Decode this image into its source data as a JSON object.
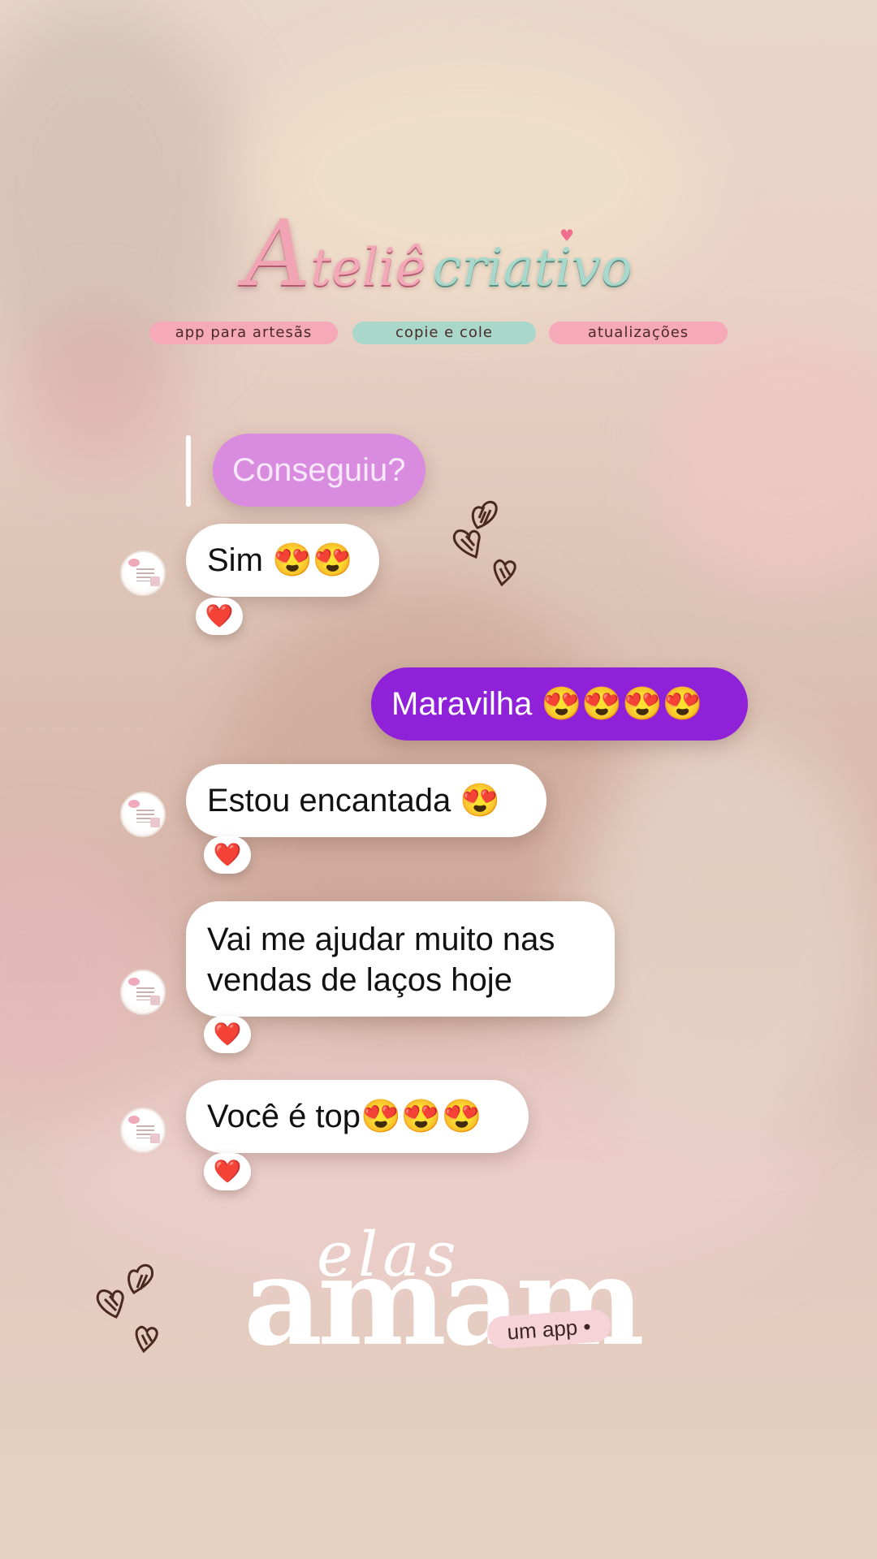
{
  "brand": {
    "logo_a": "A",
    "logo_telie": "teliê",
    "logo_criativo": "criativo",
    "tags": [
      "app para artesãs",
      "copie e cole",
      "atualizações"
    ],
    "accent_pink": "#f6a9b9",
    "accent_mint": "#a9d8cb"
  },
  "chat": {
    "reply_quote": "Conseguiu?",
    "messages": [
      {
        "text": "Sim ",
        "emoji": "😍😍",
        "reaction": "❤️"
      },
      {
        "text": "Maravilha ",
        "emoji": "😍😍😍😍",
        "outgoing": true
      },
      {
        "text": "Estou encantada ",
        "emoji": "😍",
        "reaction": "❤️"
      },
      {
        "text": "Vai me ajudar muito nas vendas de laços hoje",
        "reaction": "❤️"
      },
      {
        "text": "Você é top",
        "emoji": "😍😍😍",
        "reaction": "❤️"
      }
    ],
    "incoming_bubble_color": "#ffffff",
    "outgoing_bubble_color": "#8f22d9",
    "reply_bubble_color": "#d98be0"
  },
  "tagline": {
    "elas": "elas",
    "amam": "amam",
    "um_app": "um app •"
  },
  "icons": [
    "heart-doodle-icon",
    "heart-reaction-icon",
    "avatar-logo-icon"
  ]
}
